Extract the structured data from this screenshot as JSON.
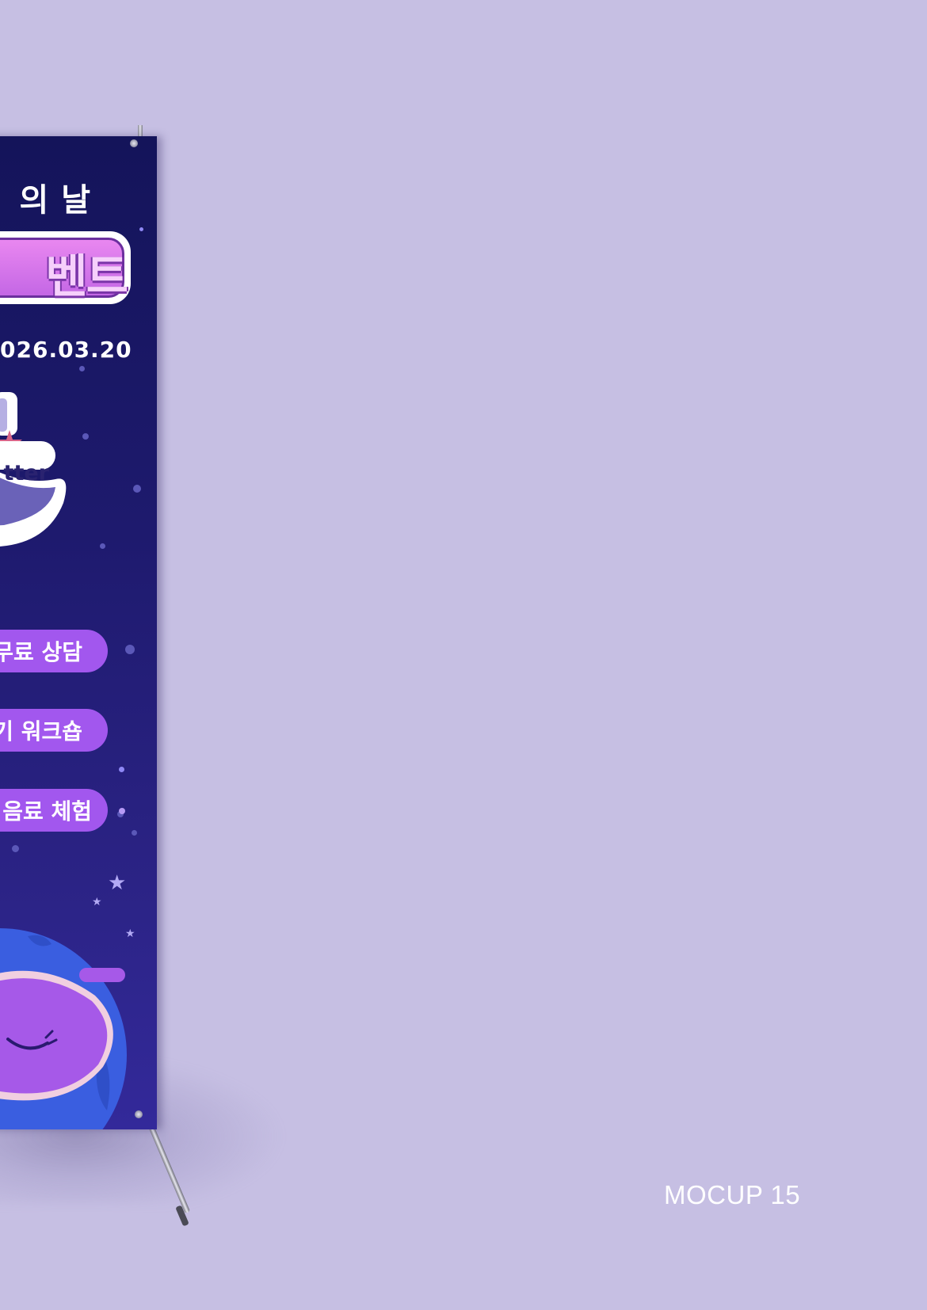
{
  "banner": {
    "title_line1": "의 날",
    "title_line2": "벤트",
    "date": "026.03.20",
    "logo_text": "tter",
    "pills": [
      {
        "label": "무료 상담"
      },
      {
        "label": "기 워크숍"
      },
      {
        "label": "음료 체험"
      }
    ]
  },
  "caption": "MOCUP 15",
  "colors": {
    "background": "#c6bfe3",
    "banner_top": "#14145a",
    "banner_bottom": "#33299a",
    "pill": "#a257ee",
    "title_pink": "#e987f0",
    "planet": "#3a5ee0"
  }
}
